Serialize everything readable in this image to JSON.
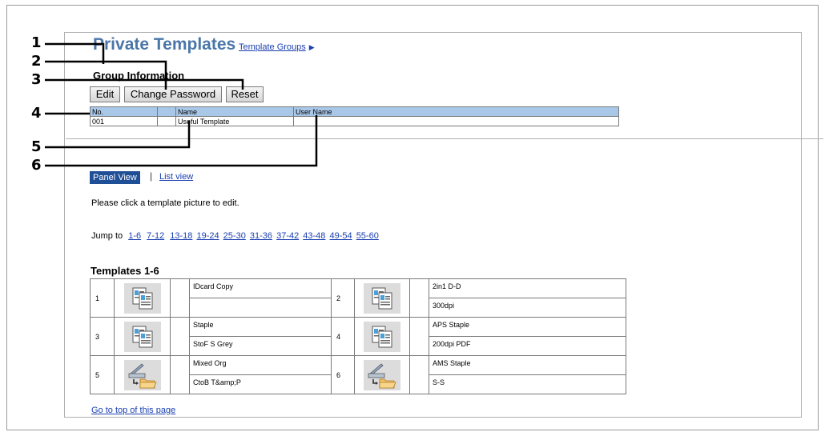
{
  "page": {
    "title": "Private Templates",
    "template_groups_link": "Template Groups",
    "template_groups_arrow": "▶",
    "group_info_title": "Group Information"
  },
  "buttons": {
    "edit": "Edit",
    "change_password": "Change Password",
    "reset": "Reset"
  },
  "group_table": {
    "headers": [
      "No.",
      "",
      "Name",
      "User Name"
    ],
    "row": [
      "001",
      "",
      "Useful Template",
      ""
    ]
  },
  "view_tabs": {
    "panel_view": "Panel View",
    "separator": "|",
    "list_view": "List view"
  },
  "instruction": "Please click a template picture to edit.",
  "jump": {
    "label": "Jump to",
    "links": [
      "1-6",
      "7-12",
      "13-18",
      "19-24",
      "25-30",
      "31-36",
      "37-42",
      "43-48",
      "49-54",
      "55-60"
    ]
  },
  "templates": {
    "heading": "Templates 1-6",
    "items": [
      {
        "num": "1",
        "icon": "copy-template-icon",
        "line1": "IDcard Copy",
        "line2": ""
      },
      {
        "num": "2",
        "icon": "copy-template-icon",
        "line1": "2in1 D-D",
        "line2": "300dpi"
      },
      {
        "num": "3",
        "icon": "copy-template-icon",
        "line1": "Staple",
        "line2": "StoF S Grey"
      },
      {
        "num": "4",
        "icon": "copy-template-icon",
        "line1": "APS Staple",
        "line2": "200dpi PDF"
      },
      {
        "num": "5",
        "icon": "scan-to-folder-icon",
        "line1": "Mixed Org",
        "line2": "CtoB T&amp;P"
      },
      {
        "num": "6",
        "icon": "scan-to-folder-icon",
        "line1": "AMS Staple",
        "line2": "S-S"
      }
    ]
  },
  "go_top": "Go to top of this page",
  "callouts": [
    "1",
    "2",
    "3",
    "4",
    "5",
    "6"
  ],
  "colors": {
    "title": "#4a76a8",
    "link": "#1a3fb0",
    "header_bg": "#a9c8e8",
    "panel_view_bg": "#1f4f96"
  }
}
